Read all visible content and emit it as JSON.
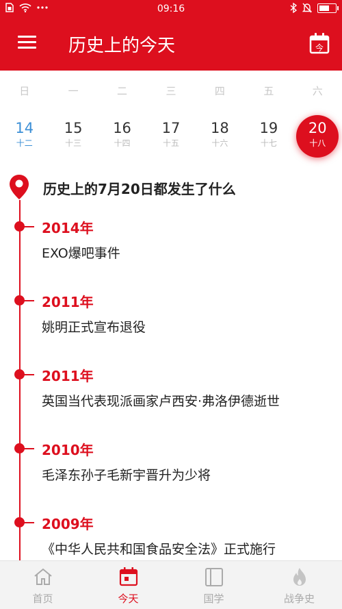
{
  "status_bar": {
    "time": "09:16",
    "left_icons": [
      "sim-icon",
      "wifi-icon",
      "more-icon"
    ],
    "right_icons": [
      "bluetooth-icon",
      "mute-icon",
      "battery-icon"
    ]
  },
  "header": {
    "title": "历史上的今天",
    "calendar_badge": "今",
    "accent_color": "#dd0f1e"
  },
  "weekdays": [
    "日",
    "一",
    "二",
    "三",
    "四",
    "五",
    "六"
  ],
  "days": [
    {
      "num": "14",
      "lunar": "十二",
      "state": "today"
    },
    {
      "num": "15",
      "lunar": "十三"
    },
    {
      "num": "16",
      "lunar": "十四"
    },
    {
      "num": "17",
      "lunar": "十五"
    },
    {
      "num": "18",
      "lunar": "十六"
    },
    {
      "num": "19",
      "lunar": "十七"
    },
    {
      "num": "20",
      "lunar": "十八",
      "state": "selected"
    }
  ],
  "section": {
    "title": "历史上的7月20日都发生了什么"
  },
  "events": [
    {
      "year": "2014年",
      "desc": "EXO爆吧事件"
    },
    {
      "year": "2011年",
      "desc": "姚明正式宣布退役"
    },
    {
      "year": "2011年",
      "desc": "英国当代表现派画家卢西安·弗洛伊德逝世"
    },
    {
      "year": "2010年",
      "desc": "毛泽东孙子毛新宇晋升为少将"
    },
    {
      "year": "2009年",
      "desc": "《中华人民共和国食品安全法》正式施行"
    }
  ],
  "tabs": [
    {
      "label": "首页",
      "icon": "home-icon"
    },
    {
      "label": "今天",
      "icon": "calendar-icon",
      "active": true
    },
    {
      "label": "国学",
      "icon": "book-icon"
    },
    {
      "label": "战争史",
      "icon": "flame-icon"
    }
  ]
}
